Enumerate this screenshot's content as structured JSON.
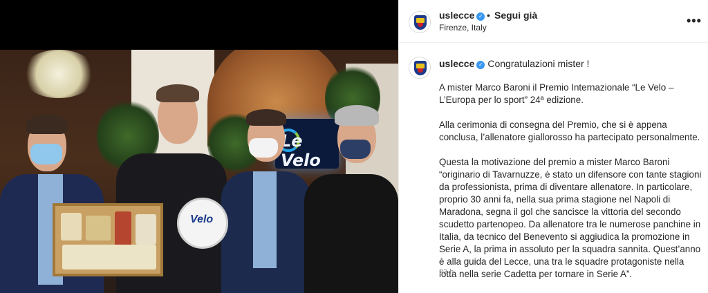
{
  "post": {
    "photo": {
      "screen_logo_text": "Le Velo",
      "plaque_text": "Velo"
    },
    "header": {
      "username": "uslecce",
      "separator": "•",
      "follow_label": "Segui già",
      "location": "Firenze, Italy",
      "more_label": "•••"
    },
    "caption": {
      "username": "uslecce",
      "first_line": "Congratulazioni mister !",
      "paragraphs": [
        "A mister Marco Baroni il Premio Internazionale “Le Velo – L’Europa per lo sport” 24ª edizione.",
        "Alla cerimonia di consegna del Premio, che si è appena conclusa, l’allenatore giallorosso ha partecipato personalmente.",
        "Questa la motivazione del premio a mister Marco Baroni “originario di Tavarnuzze, è stato un difensore con tante stagioni da professionista, prima di diventare allenatore. In particolare, proprio 30 anni fa, nella sua prima stagione nel Napoli di Maradona, segna il gol che sancisce la vittoria del secondo scudetto partenopeo. Da allenatore tra le numerose panchine in Italia, da tecnico del Benevento si aggiudica la promozione in Serie A, la prima in assoluto per la squadra sannita. Quest’anno è alla guida del Lecce, una tra le squadre protagoniste nella lotta nella serie Cadetta per tornare in Serie A”."
      ],
      "timestamp": "23 h"
    },
    "colors": {
      "verified_badge": "#3897f0",
      "text": "#262626",
      "muted": "#8e8e8e"
    }
  }
}
